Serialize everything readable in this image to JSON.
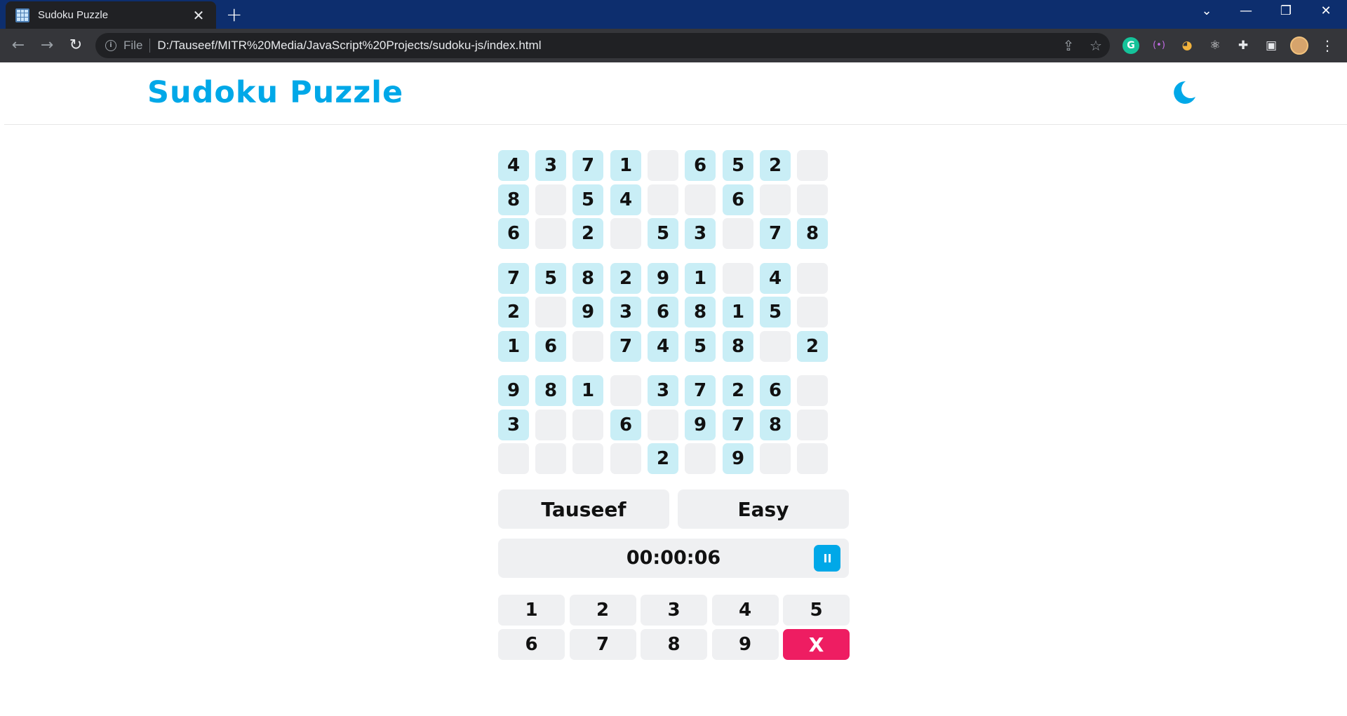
{
  "browser": {
    "tab_title": "Sudoku Puzzle",
    "tab_close": "✕",
    "new_tab": "+",
    "file_label": "File",
    "url": "D:/Tauseef/MITR%20Media/JavaScript%20Projects/sudoku-js/index.html",
    "window_controls": [
      "⌄",
      "—",
      "❐",
      "✕"
    ],
    "icons": [
      "back-icon",
      "forward-icon",
      "reload-icon",
      "info-icon",
      "share-icon",
      "bookmark-star-icon",
      "grammarly-icon",
      "extension-icon",
      "react-devtools-icon",
      "puzzle-extensions-icon",
      "side-panel-icon",
      "profile-avatar",
      "menu-icon"
    ]
  },
  "app": {
    "title": "Sudoku Puzzle",
    "theme_icon": "moon-icon",
    "accent_color": "#00a8e8",
    "filled_cell_color": "#c9eef6",
    "empty_cell_color": "#eff0f2",
    "delete_color": "#ee1d62"
  },
  "grid": [
    [
      "4",
      "3",
      "7",
      "1",
      "",
      "6",
      "5",
      "2",
      ""
    ],
    [
      "8",
      "",
      "5",
      "4",
      "",
      "",
      "6",
      "",
      ""
    ],
    [
      "6",
      "",
      "2",
      "",
      "5",
      "3",
      "",
      "7",
      "8"
    ],
    [
      "7",
      "5",
      "8",
      "2",
      "9",
      "1",
      "",
      "4",
      ""
    ],
    [
      "2",
      "",
      "9",
      "3",
      "6",
      "8",
      "1",
      "5",
      ""
    ],
    [
      "1",
      "6",
      "",
      "7",
      "4",
      "5",
      "8",
      "",
      "2"
    ],
    [
      "9",
      "8",
      "1",
      "",
      "3",
      "7",
      "2",
      "6",
      ""
    ],
    [
      "3",
      "",
      "",
      "6",
      "",
      "9",
      "7",
      "8",
      ""
    ],
    [
      "",
      "",
      "",
      "",
      "2",
      "",
      "9",
      "",
      ""
    ]
  ],
  "player_name": "Tauseef",
  "difficulty": "Easy",
  "timer": "00:00:06",
  "numpad": [
    "1",
    "2",
    "3",
    "4",
    "5",
    "6",
    "7",
    "8",
    "9"
  ],
  "delete_label": "X"
}
